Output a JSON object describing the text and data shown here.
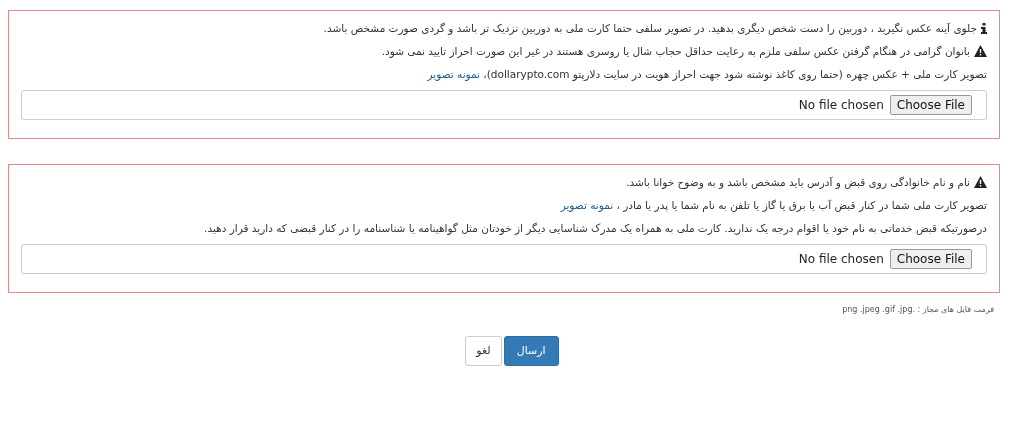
{
  "panels": [
    {
      "lines": [
        {
          "kind": "info",
          "text": "جلوی آینه عکس نگیرید ، دوربین را دست شخص دیگری بدهید. در تصویر سلفی حتما کارت ملی به دوربین نزدیک تر باشد و گردی صورت مشخص باشد."
        },
        {
          "kind": "warning",
          "text": "بانوان گرامی در هنگام گرفتن عکس سلفی ملزم به رعایت حداقل حجاب شال یا روسری هستند در غیر این صورت احراز تایید نمی شود."
        },
        {
          "kind": "plain",
          "text": "تصویر کارت ملی + عکس چهره (حتما روی کاغذ نوشته شود جهت احراز هویت در سایت دلارپتو dollarypto.com)، ",
          "link": "نمونه تصویر"
        }
      ],
      "file": {
        "button": "Choose File",
        "status": "No file chosen"
      }
    },
    {
      "lines": [
        {
          "kind": "warning",
          "text": "نام و نام خانوادگی روی قبض و آدرس باید مشخص باشد و به وضوح خوانا باشد."
        },
        {
          "kind": "plain",
          "text": "تصویر کارت ملی شما در کنار قبض آب یا برق یا گاز یا تلفن به نام شما یا پدر یا مادر ، ",
          "link": "نمونه تصویر"
        },
        {
          "kind": "plain",
          "text": "درصورتیکه قبض خدماتی به نام خود یا اقوام درجه یک ندارید. کارت ملی به همراه یک مدرک شناسایی دیگر از خودتان مثل گواهینامه یا شناسنامه را در کنار قبضی که دارید قرار دهید."
        }
      ],
      "file": {
        "button": "Choose File",
        "status": "No file chosen"
      }
    }
  ],
  "formats_note": "فرمت فایل های مجاز : .png .jpeg .gif .jpg",
  "buttons": [
    {
      "label": "ارسال",
      "kind": "primary"
    },
    {
      "label": "لغو",
      "kind": "default"
    }
  ]
}
